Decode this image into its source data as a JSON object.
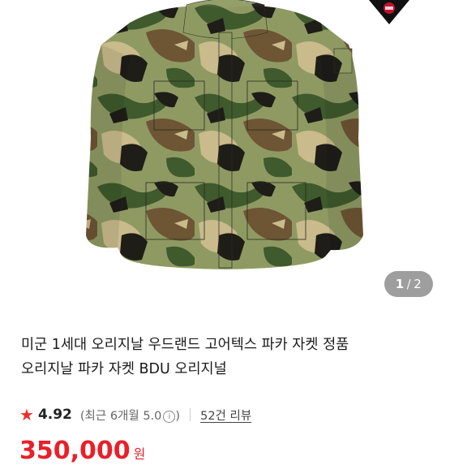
{
  "product": {
    "title_line1": "미군 1세대 오리지날 우드랜드 고어텍스 파카 자켓 정품",
    "title_line2": "오리지날 파카 자켓 BDU 오리지널",
    "image_icon": "camouflage-parka-photo",
    "brand_icon": "gore-tex-logo-icon"
  },
  "carousel": {
    "current": "1",
    "separator": "/",
    "total": "2"
  },
  "rating": {
    "score": "4.92",
    "detail_prefix": "(최근 6개월 5.0",
    "info_glyph": "i",
    "detail_suffix": ")",
    "reviews_link": "52건 리뷰"
  },
  "price": {
    "value": "350,000",
    "unit": "원"
  },
  "colors": {
    "accent_red": "#e8202a",
    "star": "#ef2d2d"
  }
}
